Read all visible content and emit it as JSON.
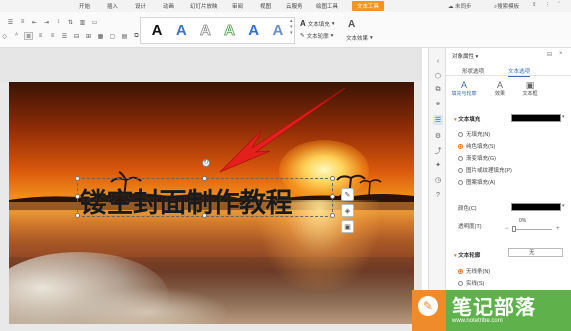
{
  "ribbon": {
    "tabs": [
      "开始",
      "插入",
      "设计",
      "动画",
      "幻灯片放映",
      "审阅",
      "视图",
      "云服务",
      "绘图工具",
      "文本工具"
    ],
    "active_tab": "文本工具",
    "right": {
      "unsaved": "未同步",
      "search": "搜索模板"
    },
    "wordart_samples": [
      "A",
      "A",
      "A",
      "A",
      "A",
      "A"
    ],
    "text_fill": "文本填充",
    "text_outline": "文本轮廓",
    "text_effect": "文本效果"
  },
  "slide": {
    "title": "镂空封面制作教程"
  },
  "panel": {
    "title": "对象属性",
    "tabs": [
      "形状选项",
      "文本选项"
    ],
    "active_tab": "文本选项",
    "subtabs": [
      "填充与轮廓",
      "效果",
      "文本框"
    ],
    "fill_section": "文本填充",
    "fill_options": [
      "无填充(N)",
      "纯色填充(S)",
      "渐变填充(G)",
      "图片或纹理填充(P)",
      "图案填充(A)"
    ],
    "fill_selected": "纯色填充(S)",
    "color_label": "颜色(C)",
    "transparency_label": "透明度(T)",
    "transparency_value": "0%",
    "outline_section": "文本轮廓",
    "outline_options": [
      "无线条(N)",
      "实线(S)"
    ],
    "outline_selected": "无线条(N)",
    "outline_select_value": "无"
  },
  "watermark": {
    "title": "笔记部落",
    "url": "www.notetribe.com",
    "faint": "教程网"
  },
  "colors": {
    "accent": "#f7941d",
    "panel_accent": "#3a6fb5",
    "arrow": "#e3201b",
    "watermark_green": "#50aa3c"
  }
}
